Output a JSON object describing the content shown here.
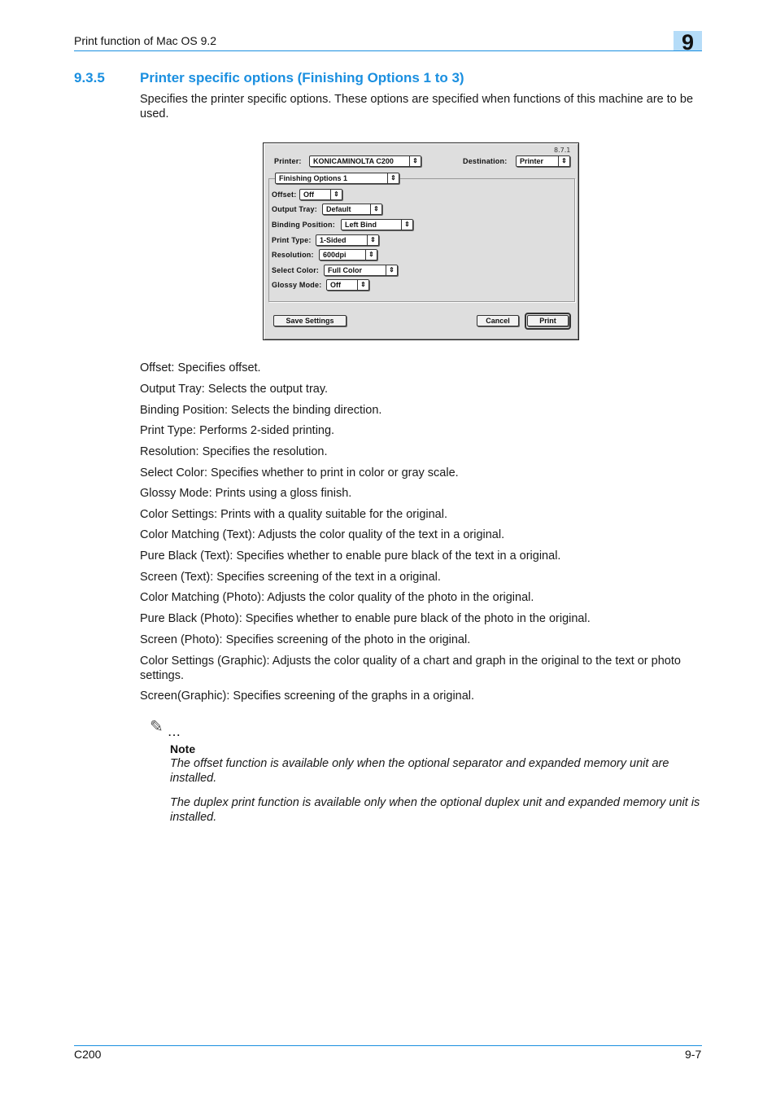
{
  "header": {
    "title": "Print function of Mac OS 9.2",
    "chapter": "9"
  },
  "section": {
    "number": "9.3.5",
    "title": "Printer specific options (Finishing Options 1 to 3)",
    "intro": "Specifies the printer specific options. These options are specified when functions of this machine are to be used."
  },
  "dialog": {
    "version": "8.7.1",
    "printer_label": "Printer:",
    "printer_value": "KONICAMINOLTA C200",
    "destination_label": "Destination:",
    "destination_value": "Printer",
    "panel_value": "Finishing Options 1",
    "options": [
      {
        "label": "Offset:",
        "value": "Off"
      },
      {
        "label": "Output Tray:",
        "value": "Default"
      },
      {
        "label": "Binding Position:",
        "value": "Left Bind"
      },
      {
        "label": "Print Type:",
        "value": "1-Sided"
      },
      {
        "label": "Resolution:",
        "value": "600dpi"
      },
      {
        "label": "Select Color:",
        "value": "Full Color"
      },
      {
        "label": "Glossy Mode:",
        "value": "Off"
      }
    ],
    "save_settings_label": "Save Settings",
    "cancel_label": "Cancel",
    "print_label": "Print",
    "popup_arrow_glyph": "⇕"
  },
  "descriptions": [
    "Offset: Specifies offset.",
    "Output Tray: Selects the output tray.",
    "Binding Position: Selects the binding direction.",
    "Print Type: Performs 2-sided printing.",
    "Resolution: Specifies the resolution.",
    "Select Color: Specifies whether to print in color or gray scale.",
    "Glossy Mode: Prints using a gloss finish.",
    "Color Settings: Prints with a quality suitable for the original.",
    "Color Matching (Text): Adjusts the color quality of the text in a original.",
    "Pure Black (Text): Specifies whether to enable pure black of the text in a original.",
    "Screen (Text): Specifies screening of the text in a original.",
    "Color Matching (Photo): Adjusts the color quality of the photo in the original.",
    "Pure Black (Photo): Specifies whether to enable pure black of the photo in the original.",
    "Screen (Photo): Specifies screening of the photo in the original.",
    "Color Settings (Graphic): Adjusts the color quality of a chart and graph in the original to the text or photo settings.",
    "Screen(Graphic): Specifies screening of the graphs in a original."
  ],
  "note": {
    "icon": "pencil-icon",
    "icon_glyph": "✎",
    "dots": "...",
    "title": "Note",
    "paragraphs": [
      "The offset function is available only when the optional separator and expanded memory unit are installed.",
      "The duplex print function is available only when the optional duplex unit and expanded memory unit is installed."
    ]
  },
  "footer": {
    "model": "C200",
    "page": "9-7"
  },
  "colors": {
    "accent": "#1a8fe0",
    "chapter_box": "#b5dcf8"
  }
}
